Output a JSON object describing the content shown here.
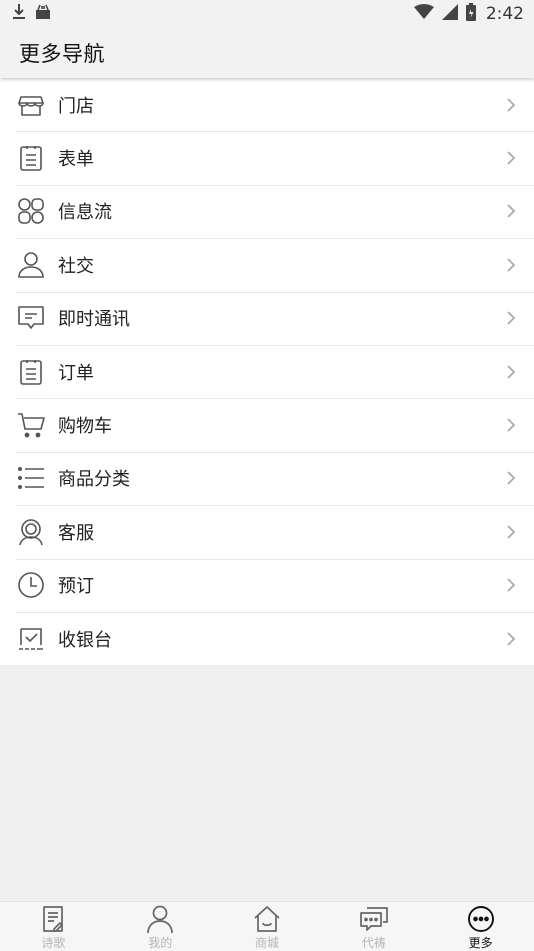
{
  "status": {
    "time": "2:42"
  },
  "header": {
    "title": "更多导航"
  },
  "menu": [
    {
      "label": "门店",
      "icon": "store-icon"
    },
    {
      "label": "表单",
      "icon": "clipboard-icon"
    },
    {
      "label": "信息流",
      "icon": "clover-icon"
    },
    {
      "label": "社交",
      "icon": "user-icon"
    },
    {
      "label": "即时通讯",
      "icon": "chat-bubble-icon"
    },
    {
      "label": "订单",
      "icon": "order-list-icon"
    },
    {
      "label": "购物车",
      "icon": "cart-icon"
    },
    {
      "label": "商品分类",
      "icon": "category-list-icon"
    },
    {
      "label": "客服",
      "icon": "customer-service-icon"
    },
    {
      "label": "预订",
      "icon": "clock-icon"
    },
    {
      "label": "收银台",
      "icon": "cashier-icon"
    }
  ],
  "tabs": [
    {
      "label": "诗歌",
      "icon": "document-edit-icon",
      "active": false
    },
    {
      "label": "我的",
      "icon": "person-icon",
      "active": false
    },
    {
      "label": "商城",
      "icon": "home-icon",
      "active": false
    },
    {
      "label": "代祷",
      "icon": "chat-icon",
      "active": false
    },
    {
      "label": "更多",
      "icon": "more-icon",
      "active": true
    }
  ],
  "colors": {
    "active_tab": "#111111",
    "inactive_tab": "#b5b5b5",
    "icon": "#555555"
  }
}
